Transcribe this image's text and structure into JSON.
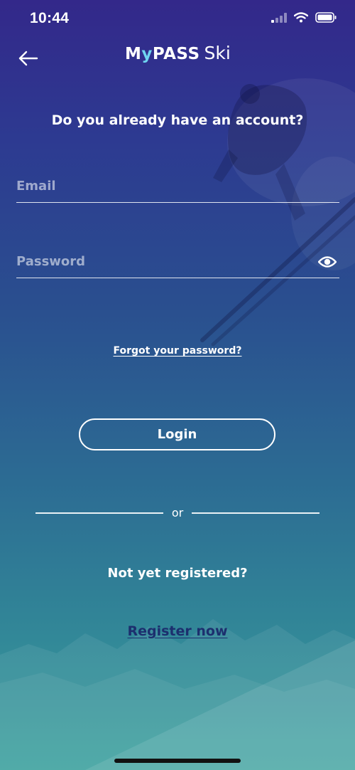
{
  "status_bar": {
    "time": "10:44",
    "icons": [
      "cellular-signal-icon",
      "wifi-icon",
      "battery-icon"
    ]
  },
  "header": {
    "back_icon": "arrow-left-icon",
    "logo": {
      "brand_parts": [
        "M",
        "y",
        "PASS"
      ],
      "sub": "Ski",
      "accent_color": "#6fd4f0"
    }
  },
  "login": {
    "heading": "Do you already have an account?",
    "email": {
      "value": "",
      "placeholder": "Email"
    },
    "password": {
      "value": "",
      "placeholder": "Password",
      "toggle_icon": "eye-icon"
    },
    "forgot_label": "Forgot your password?",
    "login_label": "Login"
  },
  "divider": {
    "label": "or"
  },
  "register": {
    "prompt": "Not yet registered?",
    "link_label": "Register now",
    "link_color": "#1c2f6e"
  },
  "theme": {
    "gradient_top": "#33288a",
    "gradient_bottom": "#3aa09c",
    "text_color": "#ffffff"
  }
}
